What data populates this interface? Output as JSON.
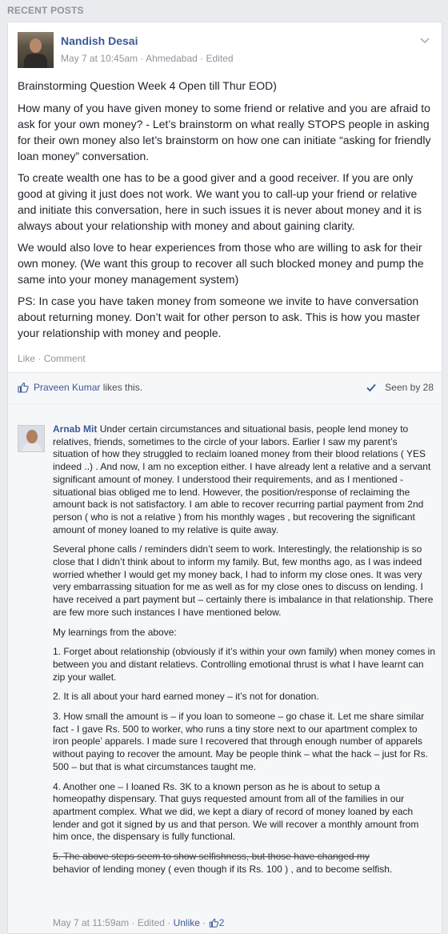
{
  "section_title": "RECENT POSTS",
  "post": {
    "author": "Nandish Desai",
    "date": "May 7 at 10:45am",
    "location": "Ahmedabad",
    "edited": "Edited",
    "separator": "·",
    "paragraphs": [
      "Brainstorming Question Week 4 Open till Thur EOD)",
      "How many of you have given money to some friend or relative and you are afraid to ask for your own money? - Let’s brainstorm on what really STOPS people in asking for their own money also let’s brainstorm on how one can initiate “asking for friendly loan money” conversation.",
      "To create wealth one has to be a good giver and a good receiver. If you are only good at giving it just does not work. We want you to call-up your friend or relative and initiate this conversation, here in such issues it is never about money and it is always about your relationship with money and about gaining clarity.",
      "We would also love to hear experiences from those who are willing to ask for their own money. (We want this group to recover all such blocked money and pump the same into your money management system)",
      "PS: In case you have taken money from someone we invite to have conversation about returning money. Don’t wait for other person to ask. This is how you master your relationship with money and people."
    ],
    "actions": {
      "like": "Like",
      "comment": "Comment"
    }
  },
  "likes": {
    "name": "Praveen Kumar",
    "suffix": " likes this.",
    "seen": "Seen by 28"
  },
  "comment": {
    "author": "Arnab Mit",
    "paragraphs": [
      "Under certain circumstances and situational basis, people lend money to relatives, friends, sometimes to the circle of your labors. Earlier I saw my parent’s situation of how they struggled to reclaim loaned money from their blood relations ( YES indeed ..) . And now, I am no exception either. I have already lent a relative and a servant significant amount of money. I understood their requirements, and as I mentioned - situational bias obliged me to lend. However, the position/response of reclaiming the amount back is not satisfactory. I am able to recover recurring partial payment from 2nd person ( who is not a relative ) from his monthly wages , but recovering the significant amount of money loaned to my relative is quite away.",
      "Several phone calls / reminders didn’t seem to work. Interestingly, the relationship is so close that I didn’t think about to inform my family. But, few months ago, as I was indeed worried whether I would get my money back, I had to inform my close ones. It was very very embarrassing situation for me as well as for my close ones to discuss on lending. I have received a part payment but – certainly there is imbalance in that relationship. There are few more such instances I have mentioned below.",
      "My learnings from the above:",
      "1. Forget about relationship (obviously if it’s within your own family) when money comes in between you and distant relatievs. Controlling emotional thrust is what I have learnt can zip your wallet.",
      "2. It is all about your hard earned money – it’s not for donation.",
      "3. How small the amount is – if you loan to someone – go chase it. Let me share similar fact - I gave Rs. 500 to worker, who runs a tiny store next to our apartment complex to iron people’ apparels. I made sure I recovered that through enough number of apparels without paying to recover the amount. May be people think – what the hack – just for Rs. 500 – but that is what circumstances taught me.",
      "4. Another one – I loaned Rs. 3K to a known person as he is about to setup a homeopathy dispensary. That guys requested amount from all of the families in our apartment complex. What we did, we kept a diary of record of money loaned by each lender and got it signed by us and that person. We will recover a monthly amount from him once, the dispensary is fully functional."
    ],
    "last_strike": "5. The above steps seem to show selfishness, but those have changed my",
    "last_rest": "behavior of lending money ( even though if its Rs. 100 ) , and to become selfish.",
    "date": "May 7 at 11:59am",
    "edited": "Edited",
    "unlike": "Unlike",
    "like_count": "2",
    "separator": "·"
  },
  "colors": {
    "link": "#3b5998",
    "meta": "#90949c",
    "background": "#e9ebee"
  }
}
